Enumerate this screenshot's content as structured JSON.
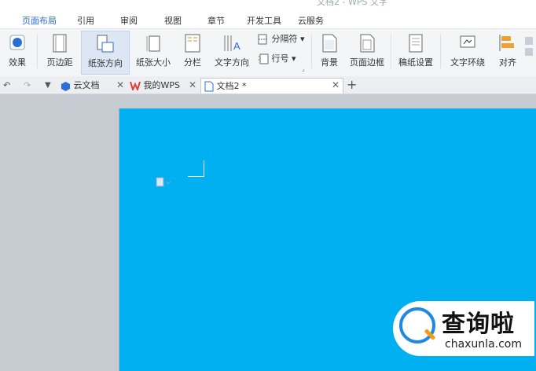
{
  "title": "文档2 - WPS 文字",
  "menu_tabs": [
    "页面布局",
    "引用",
    "审阅",
    "视图",
    "章节",
    "开发工具",
    "云服务"
  ],
  "ribbon": {
    "effect": "效果",
    "margins": "页边距",
    "orientation": "纸张方向",
    "size": "纸张大小",
    "columns": "分栏",
    "text_direction": "文字方向",
    "breaks": "分隔符",
    "line_numbers": "行号",
    "background": "背景",
    "page_border": "页面边框",
    "manuscript": "稿纸设置",
    "wrap_text": "文字环绕",
    "align": "对齐"
  },
  "doc_tabs": {
    "cloud": "云文档",
    "mywps": "我的WPS",
    "doc": "文档2 *"
  },
  "watermark": {
    "name": "查询啦",
    "site": "chaxunla.com"
  },
  "colors": {
    "accent": "#2a6fd6",
    "page_background": "#00b0f0"
  }
}
